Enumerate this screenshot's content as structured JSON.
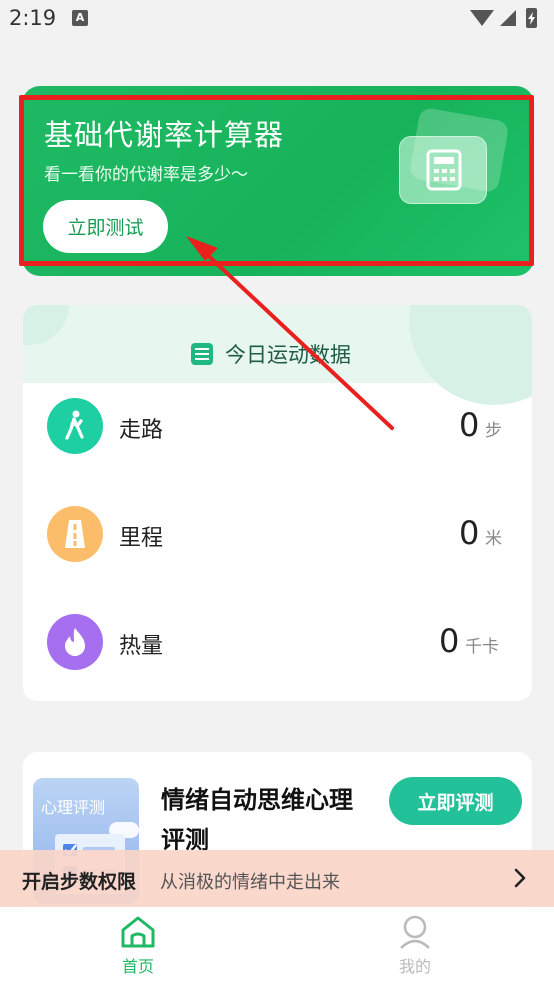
{
  "status_bar": {
    "time": "2:19",
    "notification_icon_letter": "A"
  },
  "bmr_card": {
    "title": "基础代谢率计算器",
    "subtitle": "看一看你的代谢率是多少～",
    "button_label": "立即测试"
  },
  "activity": {
    "title": "今日运动数据",
    "rows": [
      {
        "label": "走路",
        "value": "0",
        "unit": "步",
        "color": "#1fcfa4",
        "icon": "walking-icon"
      },
      {
        "label": "里程",
        "value": "0",
        "unit": "米",
        "color": "#fbbd6a",
        "icon": "road-icon"
      },
      {
        "label": "热量",
        "value": "0",
        "unit": "千卡",
        "color": "#a56ff0",
        "icon": "flame-icon"
      }
    ]
  },
  "psychology_card": {
    "image_label": "心理评测",
    "title": "情绪自动思维心理评测",
    "button_label": "立即评测"
  },
  "permission_banner": {
    "title": "开启步数权限",
    "description": "从消极的情绪中走出来"
  },
  "bottom_nav": {
    "items": [
      {
        "label": "首页",
        "active": true
      },
      {
        "label": "我的",
        "active": false
      }
    ],
    "active_color": "#1fb964",
    "inactive_color": "#bbbbbb"
  }
}
